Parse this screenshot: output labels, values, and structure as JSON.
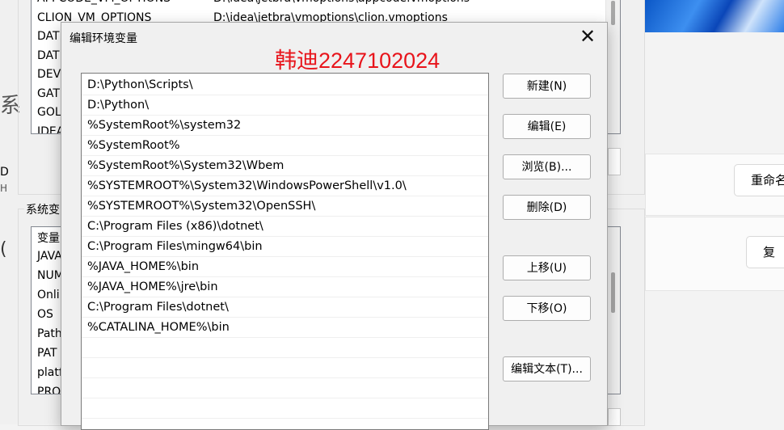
{
  "back_window": {
    "user_vars_rows": [
      {
        "name": "APPCODE_VM_OPTIONS",
        "value": "D:\\idea\\jetbra\\vmoptions\\appcode.vmoptions"
      },
      {
        "name": "CLION_VM_OPTIONS",
        "value": "D:\\idea\\jetbra\\vmoptions\\clion.vmoptions"
      },
      {
        "name": "DAT",
        "value": ""
      },
      {
        "name": "DAT",
        "value": ""
      },
      {
        "name": "DEV",
        "value": ""
      },
      {
        "name": "GAT",
        "value": ""
      },
      {
        "name": "GOL",
        "value": ""
      },
      {
        "name": "IDEA",
        "value": ""
      }
    ],
    "system_vars_label": "系统变",
    "system_vars_header": "变量",
    "system_vars_rows": [
      "JAVA",
      "NUM",
      "Onli",
      "OS",
      "Path",
      "PAT",
      "platf",
      "PRO"
    ],
    "side_glyph_1": "系",
    "side_glyph_2": "D",
    "side_glyph_3": "H"
  },
  "settings": {
    "rename_button": "重命名",
    "copy_button": "复"
  },
  "dialog": {
    "title": "编辑环境变量",
    "close_glyph": "✕",
    "watermark": "韩迪2247102024",
    "paths": [
      "D:\\Python\\Scripts\\",
      "D:\\Python\\",
      "%SystemRoot%\\system32",
      "%SystemRoot%",
      "%SystemRoot%\\System32\\Wbem",
      "%SYSTEMROOT%\\System32\\WindowsPowerShell\\v1.0\\",
      "%SYSTEMROOT%\\System32\\OpenSSH\\",
      "C:\\Program Files (x86)\\dotnet\\",
      "C:\\Program Files\\mingw64\\bin",
      "%JAVA_HOME%\\bin",
      "%JAVA_HOME%\\jre\\bin",
      "C:\\Program Files\\dotnet\\",
      "%CATALINA_HOME%\\bin"
    ],
    "buttons": {
      "new": "新建(N)",
      "edit": "编辑(E)",
      "browse": "浏览(B)...",
      "delete": "删除(D)",
      "move_up": "上移(U)",
      "move_down": "下移(O)",
      "edit_text": "编辑文本(T)..."
    }
  }
}
